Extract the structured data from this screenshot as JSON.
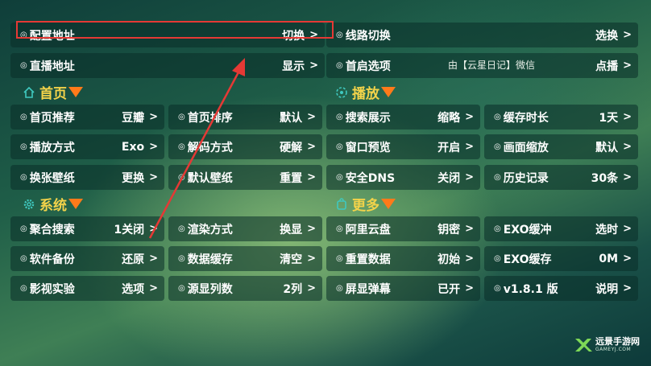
{
  "top": {
    "config_label": "配置地址",
    "config_value": "切换",
    "route_label": "线路切换",
    "route_value": "选换",
    "live_label": "直播地址",
    "live_value": "显示",
    "startup_label": "首启选项",
    "startup_ticker": "由【云星日记】微信",
    "startup_value": "点播"
  },
  "sections": {
    "home": "首页",
    "play": "播放",
    "system": "系统",
    "more": "更多"
  },
  "home_items": [
    {
      "label": "首页推荐",
      "value": "豆瓣"
    },
    {
      "label": "首页排序",
      "value": "默认"
    },
    {
      "label": "播放方式",
      "value": "Exo"
    },
    {
      "label": "解码方式",
      "value": "硬解"
    },
    {
      "label": "换张壁纸",
      "value": "更换"
    },
    {
      "label": "默认壁纸",
      "value": "重置"
    }
  ],
  "play_items": [
    {
      "label": "搜索展示",
      "value": "缩略"
    },
    {
      "label": "缓存时长",
      "value": "1天"
    },
    {
      "label": "窗口预览",
      "value": "开启"
    },
    {
      "label": "画面缩放",
      "value": "默认"
    },
    {
      "label": "安全DNS",
      "value": "关闭"
    },
    {
      "label": "历史记录",
      "value": "30条"
    }
  ],
  "system_items": [
    {
      "label": "聚合搜索",
      "value": "1关闭"
    },
    {
      "label": "渲染方式",
      "value": "换显"
    },
    {
      "label": "软件备份",
      "value": "还原"
    },
    {
      "label": "数据缓存",
      "value": "清空"
    },
    {
      "label": "影视实验",
      "value": "选项"
    },
    {
      "label": "源显列数",
      "value": "2列"
    }
  ],
  "more_items": [
    {
      "label": "阿里云盘",
      "value": "钥密"
    },
    {
      "label": "EXO缓冲",
      "value": "选时"
    },
    {
      "label": "重置数据",
      "value": "初始"
    },
    {
      "label": "EXO缓存",
      "value": "0M"
    },
    {
      "label": "屏显弹幕",
      "value": "已开"
    },
    {
      "label": "v1.8.1 版",
      "value": "说明"
    }
  ],
  "arrow_glyph": ">",
  "bullet_glyph": "◎",
  "watermark": {
    "title": "远景手游网",
    "url": "GAMEYJ.COM"
  },
  "colors": {
    "highlight": "#e53935",
    "section_text": "#f3d34a",
    "triangle": "#ff7a1a"
  }
}
